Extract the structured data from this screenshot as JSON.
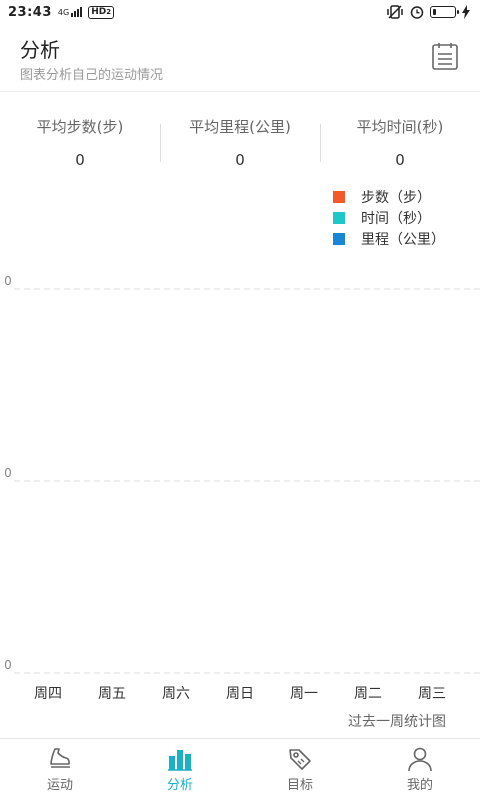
{
  "status_bar": {
    "time": "23:43",
    "network": "4G",
    "hd": "HD",
    "hd_sub": "2",
    "battery_level": 0.15
  },
  "header": {
    "title": "分析",
    "subtitle": "图表分析自己的运动情况",
    "menu_icon": "list-document-icon"
  },
  "stats": [
    {
      "label": "平均步数(步)",
      "value": "0"
    },
    {
      "label": "平均里程(公里)",
      "value": "0"
    },
    {
      "label": "平均时间(秒)",
      "value": "0"
    }
  ],
  "legend": [
    {
      "label": "步数（步）",
      "color": "#f25a2a"
    },
    {
      "label": "时间（秒）",
      "color": "#1ec8c8"
    },
    {
      "label": "里程（公里）",
      "color": "#1a85d4"
    }
  ],
  "chart_data": {
    "type": "bar",
    "categories": [
      "周四",
      "周五",
      "周六",
      "周日",
      "周一",
      "周二",
      "周三"
    ],
    "series": [
      {
        "name": "步数（步）",
        "values": [
          0,
          0,
          0,
          0,
          0,
          0,
          0
        ]
      },
      {
        "name": "时间（秒）",
        "values": [
          0,
          0,
          0,
          0,
          0,
          0,
          0
        ]
      },
      {
        "name": "里程（公里）",
        "values": [
          0,
          0,
          0,
          0,
          0,
          0,
          0
        ]
      }
    ],
    "y_tick_labels": [
      "0",
      "0",
      "0"
    ],
    "title": "",
    "xlabel": "",
    "ylabel": "",
    "ylim": [
      0,
      0
    ],
    "grid": true,
    "legend_position": "top-right"
  },
  "chart_caption": "过去一周统计图",
  "nav": {
    "items": [
      {
        "label": "运动",
        "icon": "sneaker-icon",
        "active": false
      },
      {
        "label": "分析",
        "icon": "bar-chart-icon",
        "active": true
      },
      {
        "label": "目标",
        "icon": "tag-icon",
        "active": false
      },
      {
        "label": "我的",
        "icon": "person-icon",
        "active": false
      }
    ],
    "active_color": "#1ab0c6"
  }
}
